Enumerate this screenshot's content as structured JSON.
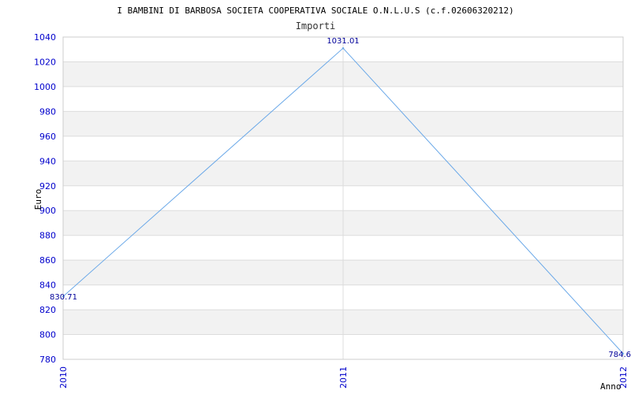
{
  "chart_data": {
    "type": "line",
    "title": "I BAMBINI DI BARBOSA SOCIETA COOPERATIVA SOCIALE O.N.L.U.S (c.f.02606320212)",
    "subtitle": "Importi",
    "xlabel": "Anno",
    "ylabel": "Euro",
    "ylim": [
      780,
      1040
    ],
    "yticks": [
      780,
      800,
      820,
      840,
      860,
      880,
      900,
      920,
      940,
      960,
      980,
      1000,
      1020,
      1040
    ],
    "x": [
      "2010",
      "2011",
      "2012"
    ],
    "series": [
      {
        "values": [
          830.71,
          1031.01,
          784.6
        ],
        "labels": [
          "830.71",
          "1031.01",
          "784.6"
        ]
      }
    ],
    "grid": true,
    "colors": {
      "line": "#6aa8e8",
      "band": "#f2f2f2",
      "grid": "#dcdcdc",
      "tick": "#0000cc",
      "data_label": "#000099"
    }
  }
}
